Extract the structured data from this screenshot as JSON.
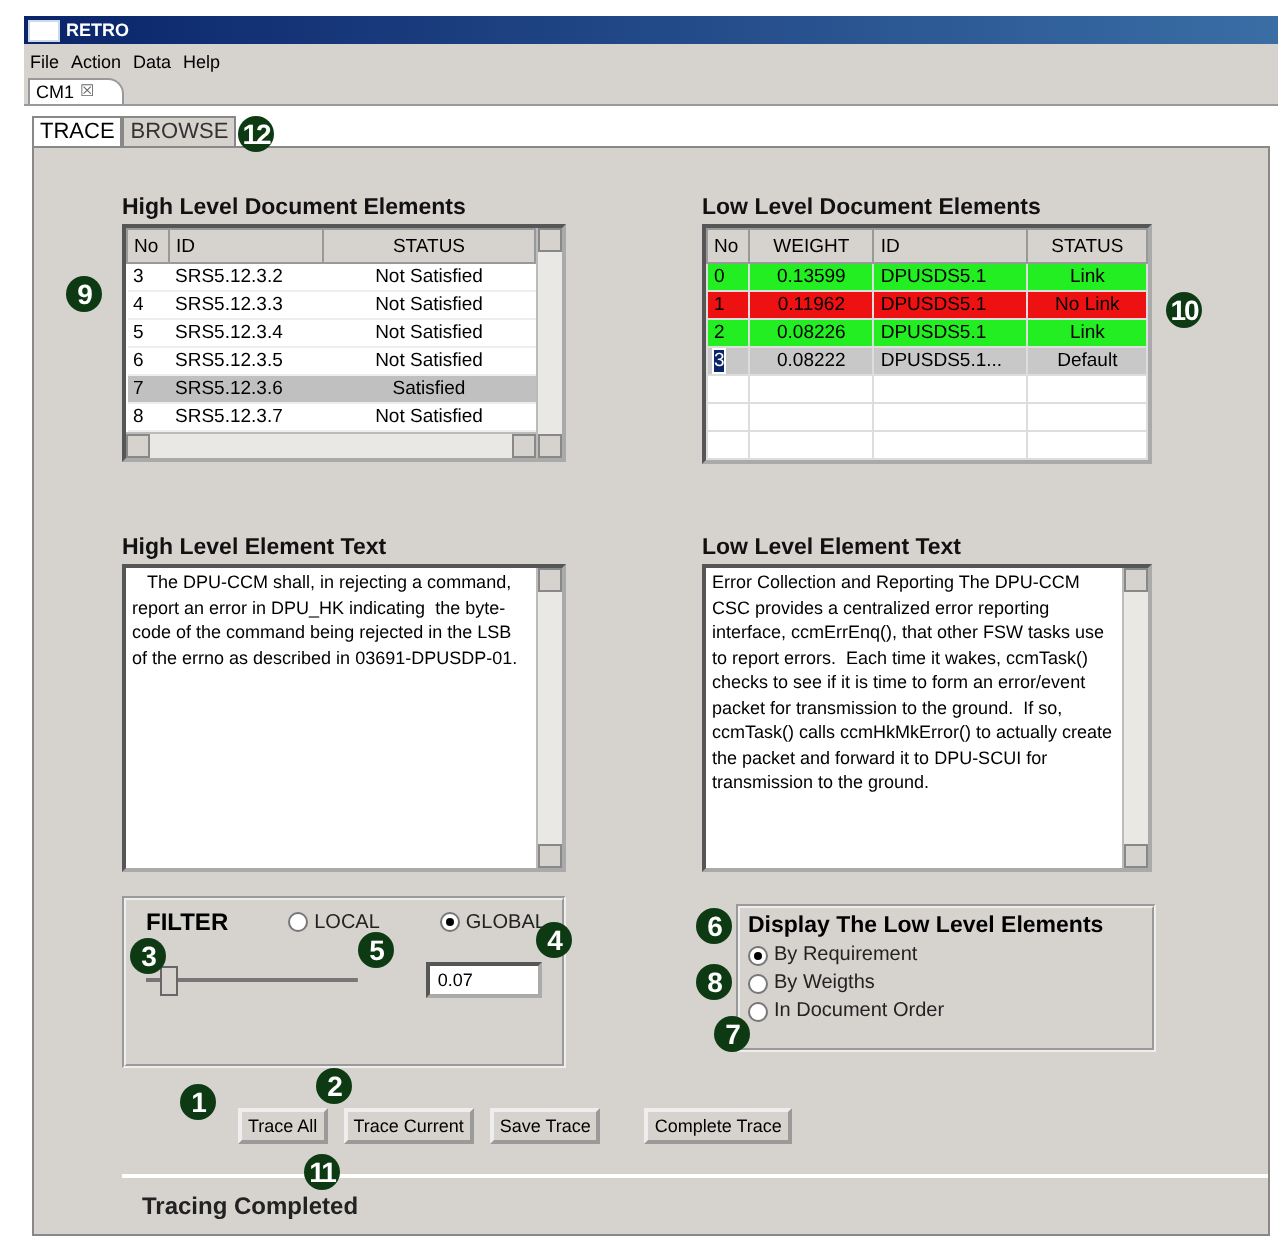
{
  "window": {
    "title": "RETRO"
  },
  "menu": [
    "File",
    "Action",
    "Data",
    "Help"
  ],
  "editor_tab": {
    "label": "CM1",
    "close": "☒"
  },
  "tabs": [
    {
      "label": "TRACE",
      "selected": true
    },
    {
      "label": "BROWSE",
      "selected": false
    }
  ],
  "high_elements": {
    "title": "High Level Document Elements",
    "columns": [
      "No",
      "ID",
      "STATUS"
    ],
    "rows": [
      {
        "no": "3",
        "id": "SRS5.12.3.2",
        "status": "Not Satisfied",
        "selected": false
      },
      {
        "no": "4",
        "id": "SRS5.12.3.3",
        "status": "Not Satisfied",
        "selected": false
      },
      {
        "no": "5",
        "id": "SRS5.12.3.4",
        "status": "Not Satisfied",
        "selected": false
      },
      {
        "no": "6",
        "id": "SRS5.12.3.5",
        "status": "Not Satisfied",
        "selected": false
      },
      {
        "no": "7",
        "id": "SRS5.12.3.6",
        "status": "Satisfied",
        "selected": true
      },
      {
        "no": "8",
        "id": "SRS5.12.3.7",
        "status": "Not Satisfied",
        "selected": false
      }
    ]
  },
  "low_elements": {
    "title": "Low Level Document Elements",
    "columns": [
      "No",
      "WEIGHT",
      "ID",
      "STATUS"
    ],
    "rows": [
      {
        "no": "0",
        "weight": "0.13599",
        "id": "DPUSDS5.1",
        "status": "Link",
        "color": "#22ee22",
        "selected": false
      },
      {
        "no": "1",
        "weight": "0.11962",
        "id": "DPUSDS5.1",
        "status": "No Link",
        "color": "#ee1111",
        "selected": false
      },
      {
        "no": "2",
        "weight": "0.08226",
        "id": "DPUSDS5.1",
        "status": "Link",
        "color": "#22ee22",
        "selected": false
      },
      {
        "no": "3",
        "weight": "0.08222",
        "id": "DPUSDS5.1...",
        "status": "Default",
        "color": "#c8c8c8",
        "selected": true
      }
    ]
  },
  "high_text": {
    "title": "High Level Element Text",
    "value": "   The DPU-CCM shall, in rejecting a command, report an error in DPU_HK indicating  the byte-code of the command being rejected in the LSB of the errno as described in 03691-DPUSDP-01."
  },
  "low_text": {
    "title": "Low Level Element Text",
    "value": "Error Collection and Reporting The DPU-CCM CSC provides a centralized error reporting interface, ccmErrEnq(), that other FSW tasks use to report errors.  Each time it wakes, ccmTask() checks to see if it is time to form an error/event packet for transmission to the ground.  If so, ccmTask() calls ccmHkMkError() to actually create the packet and forward it to DPU-SCUI for transmission to the ground."
  },
  "filter": {
    "title": "FILTER",
    "options": [
      {
        "label": "LOCAL",
        "selected": false
      },
      {
        "label": "GLOBAL",
        "selected": true
      }
    ],
    "slider": {
      "level": 0.1
    },
    "value": "0.07"
  },
  "display": {
    "title": "Display The Low Level Elements",
    "options": [
      {
        "label": "By Requirement",
        "selected": true
      },
      {
        "label": "By Weigths",
        "selected": false
      },
      {
        "label": "In Document Order",
        "selected": false
      }
    ]
  },
  "buttons": [
    "Trace All",
    "Trace Current",
    "Save Trace",
    "Complete Trace"
  ],
  "status_bar": "Tracing Completed",
  "callouts": [
    {
      "label": "12"
    },
    {
      "label": "9"
    },
    {
      "label": "10"
    },
    {
      "label": "3"
    },
    {
      "label": "5"
    },
    {
      "label": "4"
    },
    {
      "label": "6"
    },
    {
      "label": "8"
    },
    {
      "label": "7"
    },
    {
      "label": "1"
    },
    {
      "label": "2"
    },
    {
      "label": "11"
    }
  ]
}
